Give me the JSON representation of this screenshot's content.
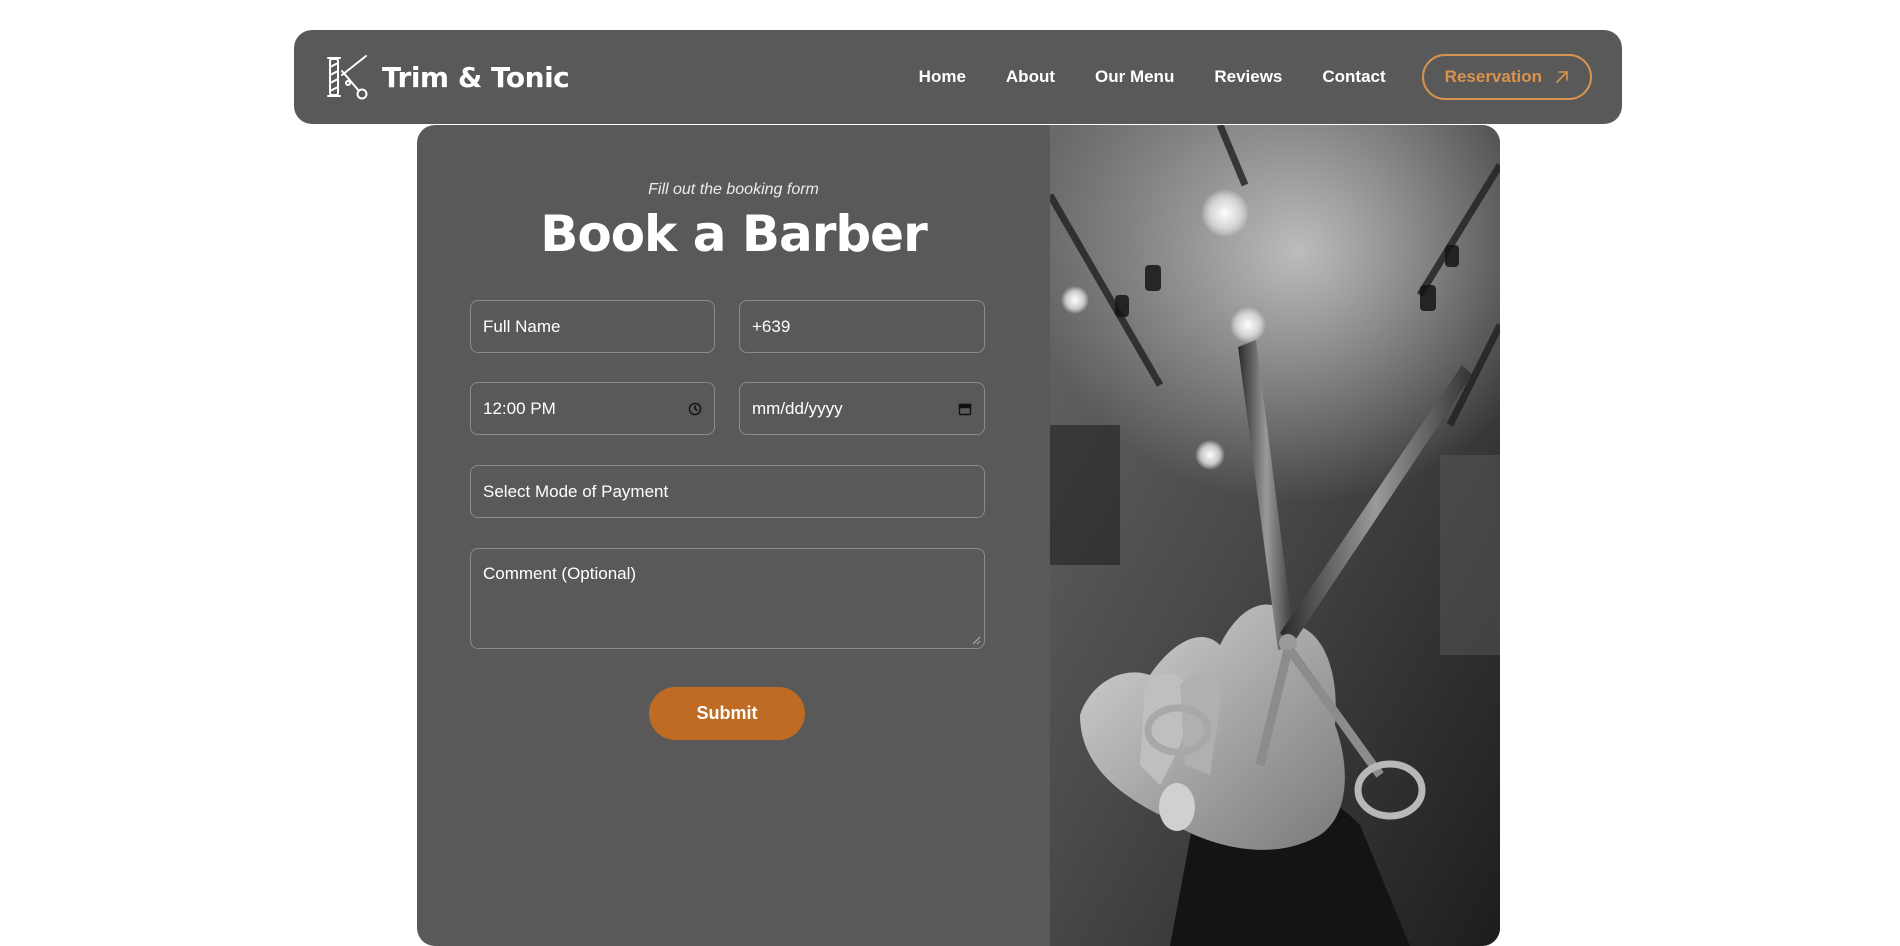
{
  "header": {
    "brand_name": "Trim & Tonic",
    "logo_icon": "barber-pole-scissors-icon",
    "nav": [
      {
        "label": "Home"
      },
      {
        "label": "About"
      },
      {
        "label": "Our Menu"
      },
      {
        "label": "Reviews"
      },
      {
        "label": "Contact"
      }
    ],
    "cta_label": "Reservation",
    "cta_icon": "arrow-up-right-icon",
    "cta_color": "#d8944f"
  },
  "booking": {
    "subtitle": "Fill out the booking form",
    "title": "Book a Barber",
    "fields": {
      "full_name_placeholder": "Full Name",
      "phone_placeholder": "+639",
      "time_value": "12:00 PM",
      "time_icon": "clock-icon",
      "date_placeholder": "mm/dd/yyyy",
      "date_icon": "calendar-icon",
      "payment_placeholder": "Select Mode of Payment",
      "comment_placeholder": "Comment (Optional)"
    },
    "submit_label": "Submit",
    "submit_color": "#bf6b24"
  },
  "photo": {
    "subject": "hand holding barber scissors, grayscale"
  },
  "colors": {
    "panel_bg": "#595959",
    "page_bg": "#ffffff"
  }
}
